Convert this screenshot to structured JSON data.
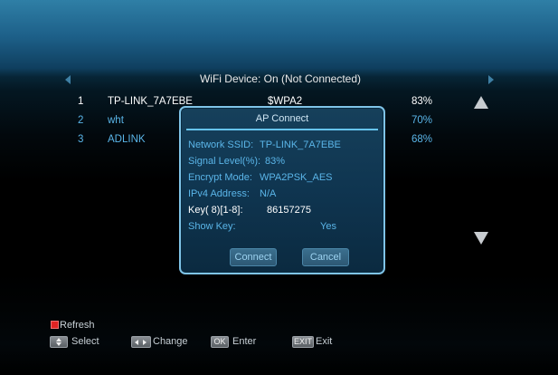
{
  "header": {
    "title": "WiFi Device: On (Not Connected)"
  },
  "wifi_list": [
    {
      "num": "1",
      "ssid": "TP-LINK_7A7EBE",
      "encryption": "$WPA2",
      "signal": "83%"
    },
    {
      "num": "2",
      "ssid": "wht",
      "encryption": "",
      "signal": "70%"
    },
    {
      "num": "3",
      "ssid": "ADLINK",
      "encryption": "",
      "signal": "68%"
    }
  ],
  "dialog": {
    "title": "AP Connect",
    "ssid_label": "Network SSID:",
    "ssid_value": "TP-LINK_7A7EBE",
    "signal_label": "Signal Level(%):",
    "signal_value": "83%",
    "encrypt_label": "Encrypt Mode:",
    "encrypt_value": "WPA2PSK_AES",
    "ipv4_label": "IPv4 Address:",
    "ipv4_value": "N/A",
    "key_label": "Key( 8)[1-8]:",
    "key_value": "86157275",
    "showkey_label": "Show Key:",
    "showkey_value": "Yes",
    "connect_label": "Connect",
    "cancel_label": "Cancel"
  },
  "legend": {
    "refresh": "Refresh",
    "select": "Select",
    "change": "Change",
    "ok_key": "OK",
    "enter": "Enter",
    "exit_key": "EXIT",
    "exit": "Exit"
  },
  "colors": {
    "accent_blue": "#5ab5e8",
    "refresh_red": "#e02323",
    "dialog_border": "#7fc4e8"
  }
}
